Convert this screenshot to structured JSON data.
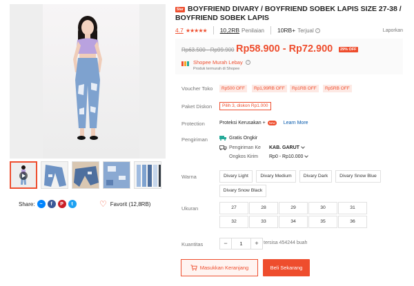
{
  "product": {
    "star_badge": "Star",
    "title_line1": "BOYFRIEND DIVARY / BOYFRIEND SOBEK LAPIS SIZE 27-38 /",
    "title_line2": "BOYFRIEND SOBEK LAPIS"
  },
  "rating": {
    "score": "4.7",
    "stars": "★★★★★",
    "reviews_count": "10,2RB",
    "reviews_label": "Penilaian",
    "sold_count": "10RB+",
    "sold_label": "Terjual",
    "report": "Laporkan"
  },
  "price": {
    "original": "Rp63.500 - Rp99.900",
    "current": "Rp58.900 - Rp72.900",
    "discount": "29% OFF"
  },
  "mall": {
    "name": "Shopee Murah Lebay",
    "subtitle": "Produk termurah di Shopee"
  },
  "labels": {
    "voucher": "Voucher Toko",
    "bundle": "Paket Diskon",
    "protection": "Protection",
    "shipping": "Pengiriman",
    "color": "Warna",
    "size": "Ukuran",
    "quantity": "Kuantitas"
  },
  "vouchers": [
    "Rp500 OFF",
    "Rp1,99RB OFF",
    "Rp1RB OFF",
    "Rp5RB OFF"
  ],
  "bundle": "Pilih 3, diskon Rp1.000",
  "protection": {
    "text": "Proteksi Kerusakan +",
    "new_badge": "New",
    "learn_more": "Learn More"
  },
  "shipping": {
    "free": "Gratis Ongkir",
    "to_label": "Pengiriman Ke",
    "to_value": "KAB. GARUT",
    "cost_label": "Ongkos Kirim",
    "cost_value": "Rp0 - Rp10.000"
  },
  "colors": [
    "Divary Light",
    "Divary Medium",
    "Divary Dark",
    "Divary Snow Blue",
    "Divary Snow Black"
  ],
  "sizes": [
    "27",
    "28",
    "29",
    "30",
    "31",
    "32",
    "33",
    "34",
    "35",
    "36"
  ],
  "quantity": {
    "minus": "−",
    "value": "1",
    "plus": "+",
    "stock": "tersisa 454244 buah"
  },
  "actions": {
    "add_to_cart": "Masukkan Keranjang",
    "buy_now": "Beli Sekarang"
  },
  "share": {
    "label": "Share:",
    "favorite": "Favorit (12,8RB)"
  },
  "colors_theme": {
    "accent": "#ee4d2d",
    "link": "#0055aa",
    "muted": "#757575"
  },
  "icons": [
    "play-icon",
    "messenger-icon",
    "facebook-icon",
    "pinterest-icon",
    "twitter-icon",
    "heart-icon",
    "question-icon",
    "truck-icon",
    "free-shipping-icon",
    "cart-icon",
    "chevron-down-icon"
  ]
}
